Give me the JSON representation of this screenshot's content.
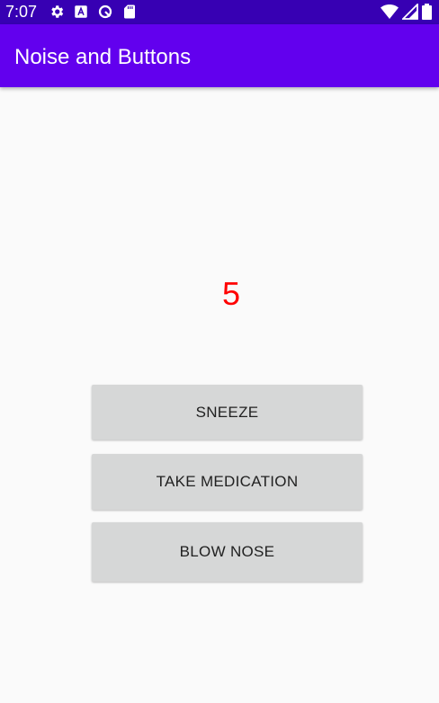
{
  "status_bar": {
    "time": "7:07",
    "left_icons": [
      "gear-icon",
      "a-icon",
      "sync-icon",
      "sd-card-icon"
    ],
    "right_icons": [
      "wifi-icon",
      "cell-signal-icon",
      "battery-icon"
    ],
    "background": "#3700b3"
  },
  "app_bar": {
    "title": "Noise and Buttons",
    "background": "#6200ee"
  },
  "main": {
    "counter_value": "5",
    "counter_color": "#ff0000",
    "buttons": [
      {
        "label": "SNEEZE"
      },
      {
        "label": "TAKE MEDICATION"
      },
      {
        "label": "BLOW NOSE"
      }
    ]
  }
}
